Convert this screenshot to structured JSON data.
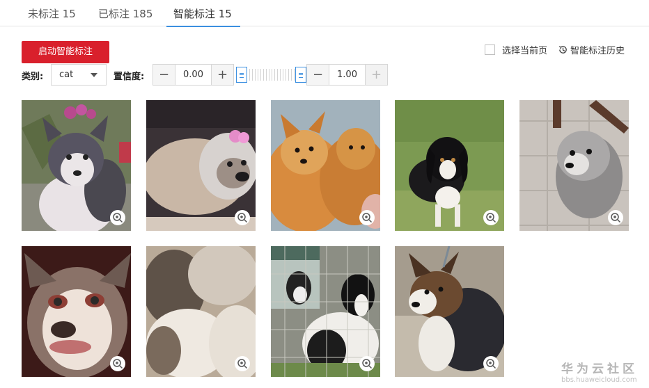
{
  "tabs": [
    {
      "label": "未标注 15"
    },
    {
      "label": "已标注 185"
    },
    {
      "label": "智能标注 15",
      "active": true
    }
  ],
  "toolbar": {
    "start_label": "启动智能标注",
    "select_page_label": "选择当前页",
    "history_label": "智能标注历史"
  },
  "filters": {
    "category_label": "类别:",
    "category_value": "cat",
    "confidence_label": "置信度:",
    "min_value": "0.00",
    "max_value": "1.00",
    "minus": "−",
    "plus": "+",
    "min_fraction": 0.0,
    "max_fraction": 1.0
  },
  "icons": {
    "zoom": "zoom-in-icon",
    "history": "history-icon",
    "caret": "caret-down-icon"
  },
  "colors": {
    "accent": "#d9202c",
    "tab_underline": "#3b8fe0"
  },
  "watermark": {
    "line1": "华为云社区",
    "line2": "bbs.huaweicloud.com"
  }
}
